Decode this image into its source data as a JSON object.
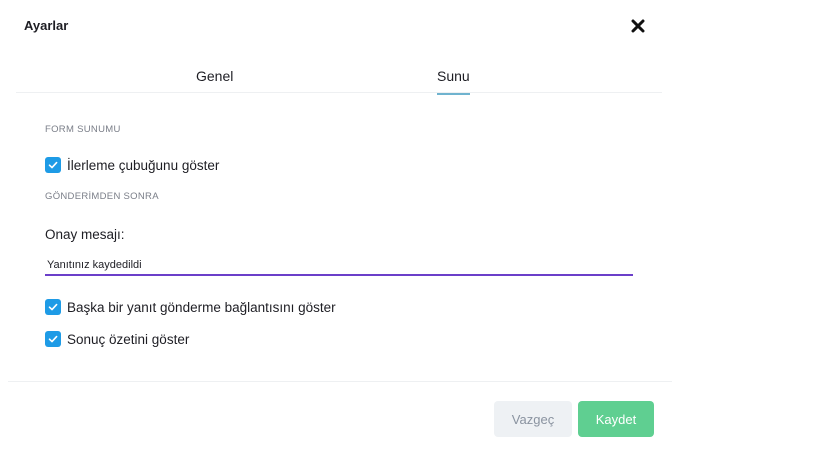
{
  "dialog": {
    "title": "Ayarlar"
  },
  "tabs": [
    {
      "label": "Genel",
      "active": false
    },
    {
      "label": "Sunu",
      "active": true
    }
  ],
  "form_presentation": {
    "section_label": "FORM SUNUMU",
    "progress_bar": {
      "label": "İlerleme çubuğunu göster",
      "checked": true
    }
  },
  "after_submission": {
    "section_label": "GÖNDERİMDEN SONRA",
    "confirmation": {
      "label": "Onay mesajı:",
      "value": "Yanıtınız kaydedildi"
    },
    "options": [
      {
        "label": "Başka bir yanıt gönderme bağlantısını göster",
        "checked": true
      },
      {
        "label": "Sonuç özetini göster",
        "checked": true
      }
    ]
  },
  "footer": {
    "cancel_label": "Vazgeç",
    "save_label": "Kaydet"
  },
  "colors": {
    "checkbox": "#1e9be6",
    "active_tab_underline": "#6fb3cf",
    "input_underline": "#6b3fc9",
    "save_button": "#5fcf91",
    "cancel_button": "#eef1f4"
  },
  "icons": {
    "close": "close-icon",
    "check": "checkmark-icon"
  }
}
